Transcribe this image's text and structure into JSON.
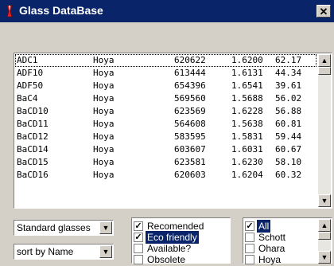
{
  "window": {
    "title": "Glass DataBase",
    "close_glyph": "✕",
    "icon": "glass-prism-icon"
  },
  "glass_list": {
    "rows": [
      {
        "name": "ADC1",
        "maker": "Hoya",
        "code": "620622",
        "nd": "1.6200",
        "vd": "62.17"
      },
      {
        "name": "ADF10",
        "maker": "Hoya",
        "code": "613444",
        "nd": "1.6131",
        "vd": "44.34"
      },
      {
        "name": "ADF50",
        "maker": "Hoya",
        "code": "654396",
        "nd": "1.6541",
        "vd": "39.61"
      },
      {
        "name": "BaC4",
        "maker": "Hoya",
        "code": "569560",
        "nd": "1.5688",
        "vd": "56.02"
      },
      {
        "name": "BaCD10",
        "maker": "Hoya",
        "code": "623569",
        "nd": "1.6228",
        "vd": "56.88"
      },
      {
        "name": "BaCD11",
        "maker": "Hoya",
        "code": "564608",
        "nd": "1.5638",
        "vd": "60.81"
      },
      {
        "name": "BaCD12",
        "maker": "Hoya",
        "code": "583595",
        "nd": "1.5831",
        "vd": "59.44"
      },
      {
        "name": "BaCD14",
        "maker": "Hoya",
        "code": "603607",
        "nd": "1.6031",
        "vd": "60.67"
      },
      {
        "name": "BaCD15",
        "maker": "Hoya",
        "code": "623581",
        "nd": "1.6230",
        "vd": "58.10"
      },
      {
        "name": "BaCD16",
        "maker": "Hoya",
        "code": "620603",
        "nd": "1.6204",
        "vd": "60.32"
      }
    ]
  },
  "filters": {
    "glass_set": {
      "value": "Standard glasses"
    },
    "sort": {
      "value": "sort by Name"
    },
    "status_options": [
      {
        "label": "Recomended",
        "checked": true,
        "highlighted": false
      },
      {
        "label": "Eco friendly",
        "checked": true,
        "highlighted": true
      },
      {
        "label": "Available?",
        "checked": false,
        "highlighted": false
      },
      {
        "label": "Obsolete",
        "checked": false,
        "highlighted": false
      }
    ],
    "makers": [
      {
        "label": "All",
        "checked": true,
        "highlighted": true
      },
      {
        "label": "Schott",
        "checked": false,
        "highlighted": false
      },
      {
        "label": "Ohara",
        "checked": false,
        "highlighted": false
      },
      {
        "label": "Hoya",
        "checked": false,
        "highlighted": false
      }
    ]
  },
  "glyphs": {
    "up": "▲",
    "down": "▼",
    "check": "✓"
  },
  "colors": {
    "title_bar": "#0a246a",
    "face": "#d4d0c8",
    "highlight": "#0a246a"
  }
}
